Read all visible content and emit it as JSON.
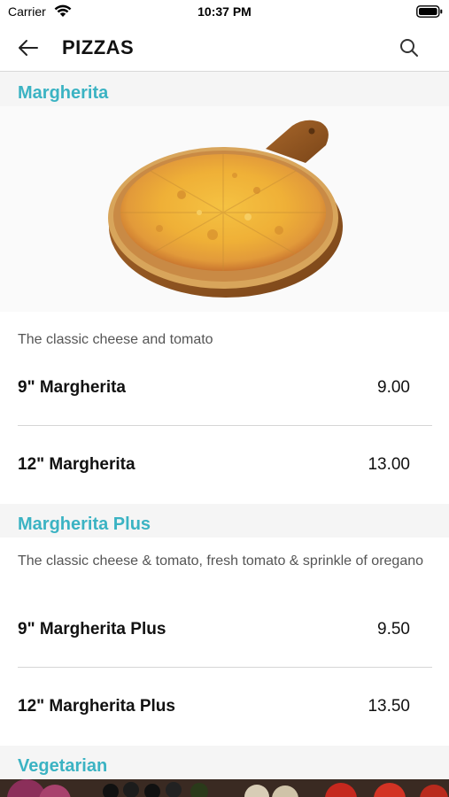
{
  "status_bar": {
    "carrier": "Carrier",
    "time": "10:37 PM"
  },
  "nav": {
    "title": "PIZZAS",
    "back_icon": "back-arrow-icon",
    "search_icon": "search-icon"
  },
  "sections": [
    {
      "title": "Margherita",
      "description": "The classic cheese and tomato",
      "items": [
        {
          "name": "9\" Margherita",
          "price": "9.00"
        },
        {
          "name": "12\" Margherita",
          "price": "13.00"
        }
      ]
    },
    {
      "title": "Margherita Plus",
      "description": "The classic cheese & tomato, fresh tomato & sprinkle of oregano",
      "items": [
        {
          "name": "9\" Margherita Plus",
          "price": "9.50"
        },
        {
          "name": "12\" Margherita Plus",
          "price": "13.50"
        }
      ]
    },
    {
      "title": "Vegetarian"
    }
  ],
  "colors": {
    "accent": "#3bb3c3",
    "section_bg": "#f5f5f5",
    "divider": "#d6d6d6"
  }
}
